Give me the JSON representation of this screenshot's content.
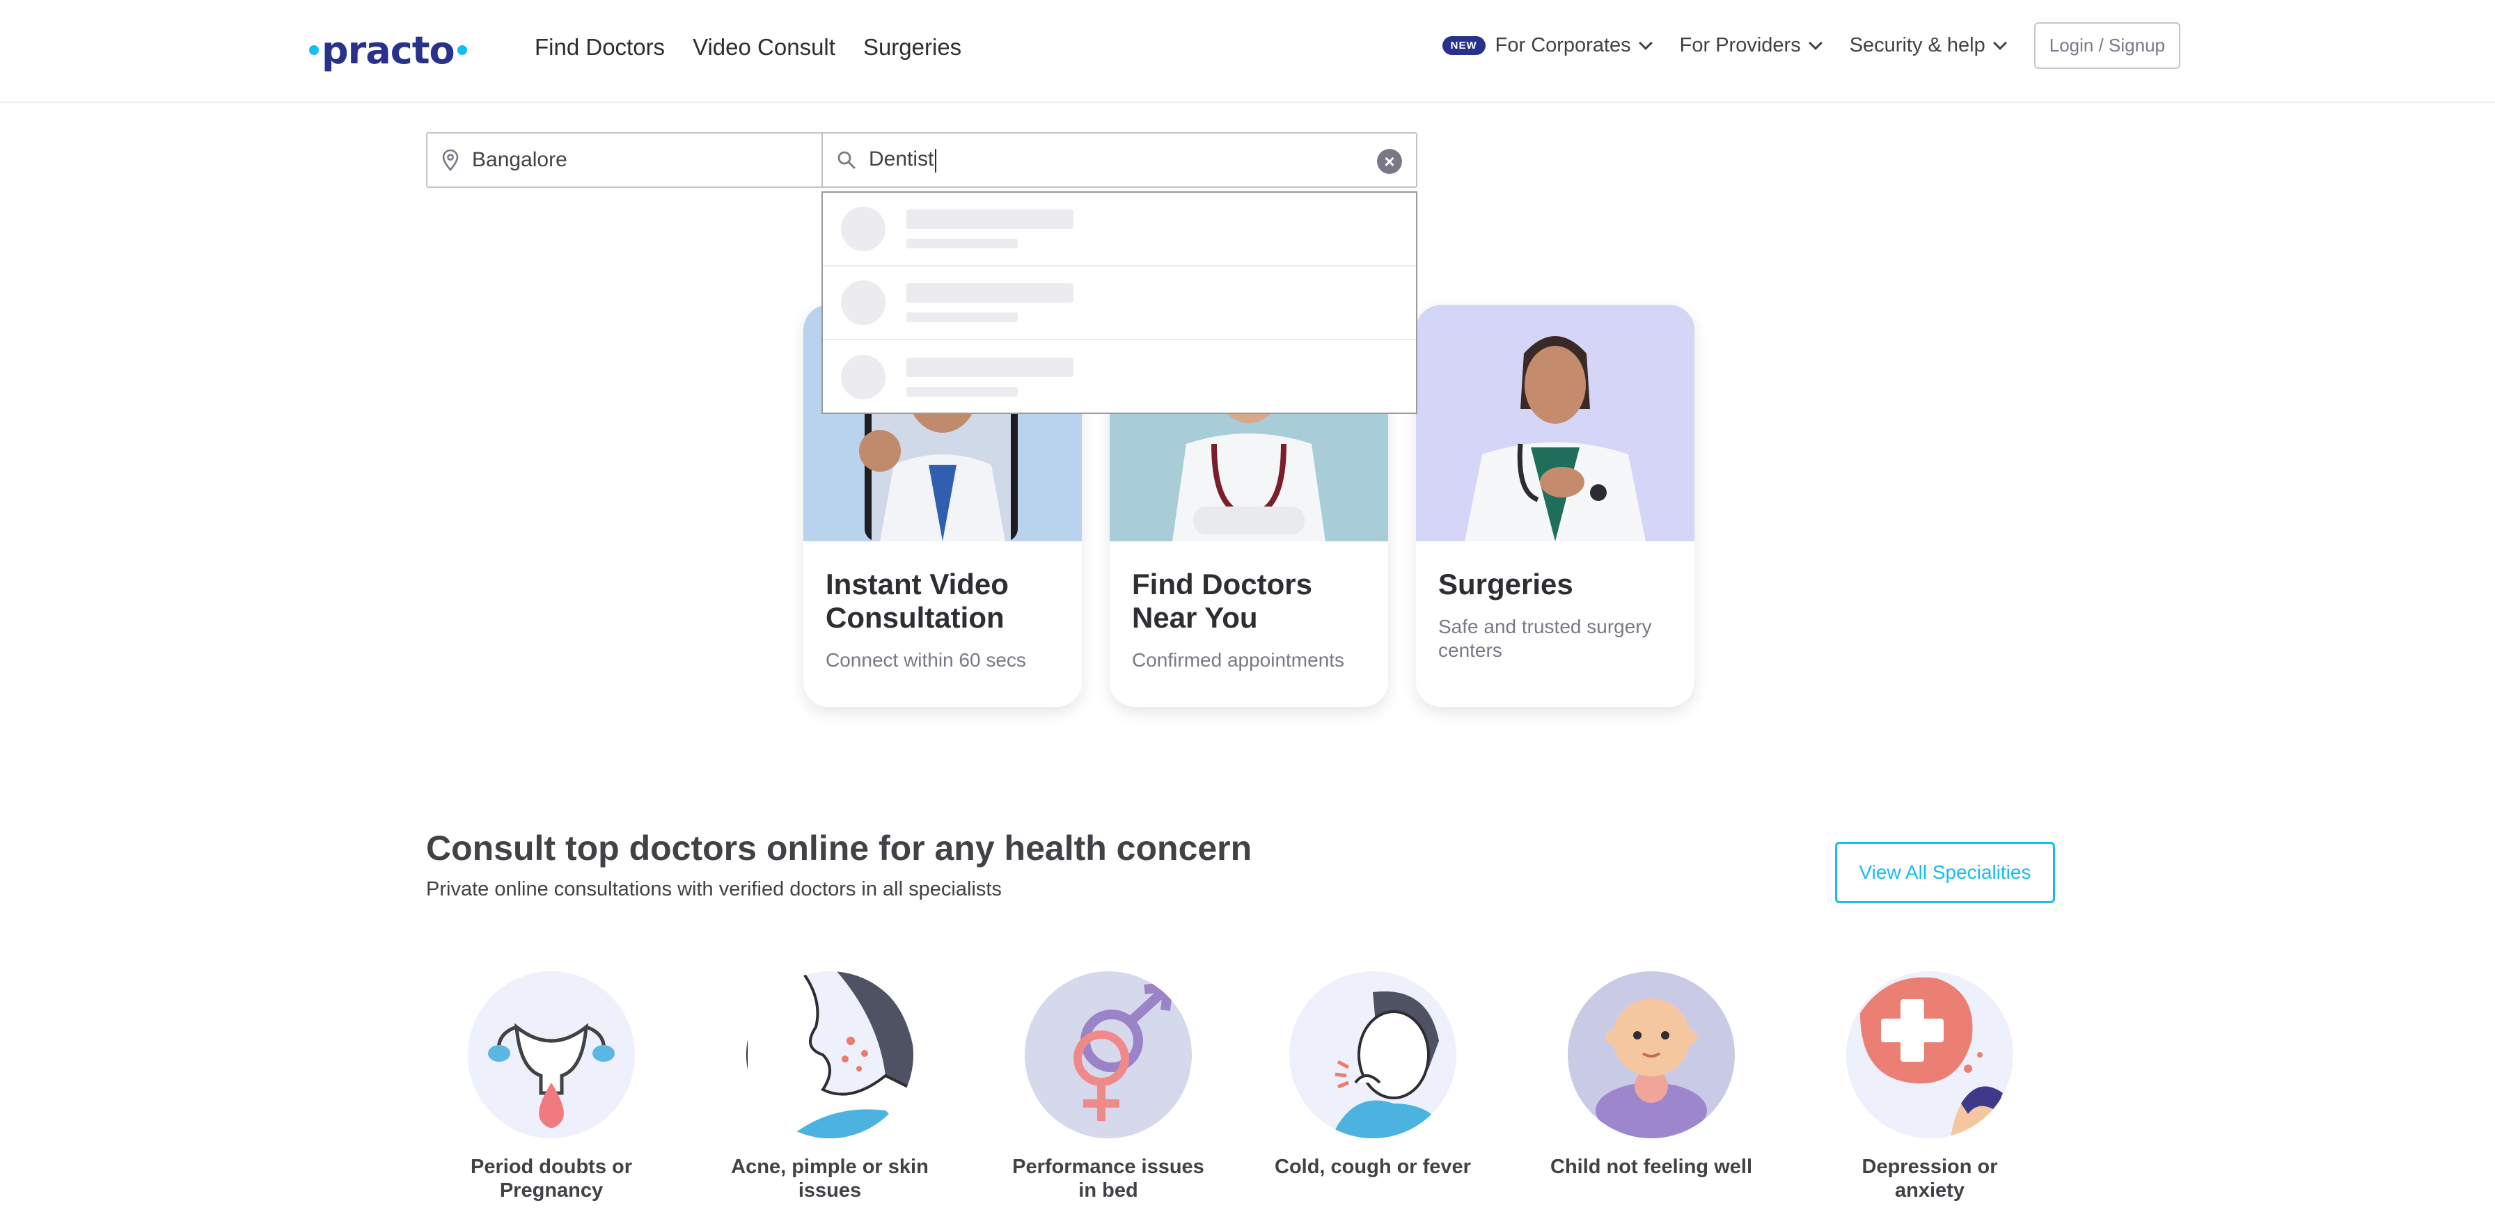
{
  "header": {
    "logo": "practo",
    "nav": [
      "Find Doctors",
      "Video Consult",
      "Surgeries"
    ],
    "corporates_badge": "NEW",
    "corporates": "For Corporates",
    "providers": "For Providers",
    "security": "Security & help",
    "login": "Login / Signup"
  },
  "search": {
    "location": "Bangalore",
    "query": "Dentist"
  },
  "cards": [
    {
      "title": "Instant Video Consultation",
      "subtitle": "Connect within 60 secs"
    },
    {
      "title": "Find Doctors Near You",
      "subtitle": "Confirmed appointments"
    },
    {
      "title": "Surgeries",
      "subtitle": "Safe and trusted surgery centers"
    }
  ],
  "consult": {
    "title": "Consult top doctors online for any health concern",
    "subtitle": "Private online consultations with verified doctors in all specialists",
    "view_all": "View All Specialities"
  },
  "specialities": [
    "Period doubts or Pregnancy",
    "Acne, pimple or skin issues",
    "Performance issues in bed",
    "Cold, cough or fever",
    "Child not feeling well",
    "Depression or anxiety"
  ],
  "colors": {
    "brand": "#14bef0",
    "brand_dark": "#28328c",
    "text": "#414146"
  }
}
